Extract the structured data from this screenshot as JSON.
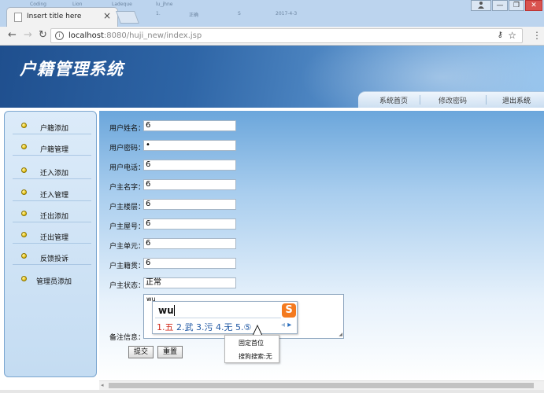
{
  "browser": {
    "tab_title": "Insert title here",
    "tab_close": "×",
    "background_window_fragments": [
      "Coding",
      "Lion",
      "Ladeque",
      "lu_jhne",
      "1.",
      "正确",
      "S",
      "2017-4-3"
    ],
    "window_controls": {
      "minimize": "—",
      "restore": "❐",
      "close": "✕"
    },
    "url_host": "localhost",
    "url_rest": ":8080/huji_new/index.jsp",
    "nav_icons": {
      "back": "←",
      "forward": "→",
      "reload": "↻",
      "info": "i",
      "key": "⚷",
      "star": "☆",
      "menu": "⋮"
    }
  },
  "header": {
    "system_title": "户籍管理系统",
    "nav": [
      "系统首页",
      "修改密码",
      "退出系统"
    ]
  },
  "sidebar": {
    "items": [
      {
        "label": "户籍添加"
      },
      {
        "label": "户籍管理"
      },
      {
        "label": "迁入添加"
      },
      {
        "label": "迁入管理"
      },
      {
        "label": "迁出添加"
      },
      {
        "label": "迁出管理"
      },
      {
        "label": "反馈投诉"
      },
      {
        "label": "管理员添加"
      }
    ]
  },
  "form": {
    "fields": [
      {
        "label": "用户姓名：",
        "value": "6"
      },
      {
        "label": "用户密码：",
        "value": "•"
      },
      {
        "label": "用户电话：",
        "value": "6"
      },
      {
        "label": "户主名字：",
        "value": "6"
      },
      {
        "label": "户主楼层：",
        "value": "6"
      },
      {
        "label": "户主屋号：",
        "value": "6"
      },
      {
        "label": "户主单元：",
        "value": "6"
      },
      {
        "label": "户主籍贯：",
        "value": "6"
      },
      {
        "label": "户主状态：",
        "value": "正常"
      }
    ],
    "remark_label": "备注信息：",
    "remark_value": "wu",
    "submit_label": "提交",
    "reset_label": "重置"
  },
  "ime": {
    "pinyin": "wu",
    "candidates": [
      "1.五",
      "2.武",
      "3.污",
      "4.无",
      "5.⑤"
    ],
    "logo": "S",
    "page_prev": "◂",
    "page_next": "▸"
  },
  "context_menu": {
    "items": [
      "固定首位",
      "搜狗搜索:无"
    ]
  }
}
